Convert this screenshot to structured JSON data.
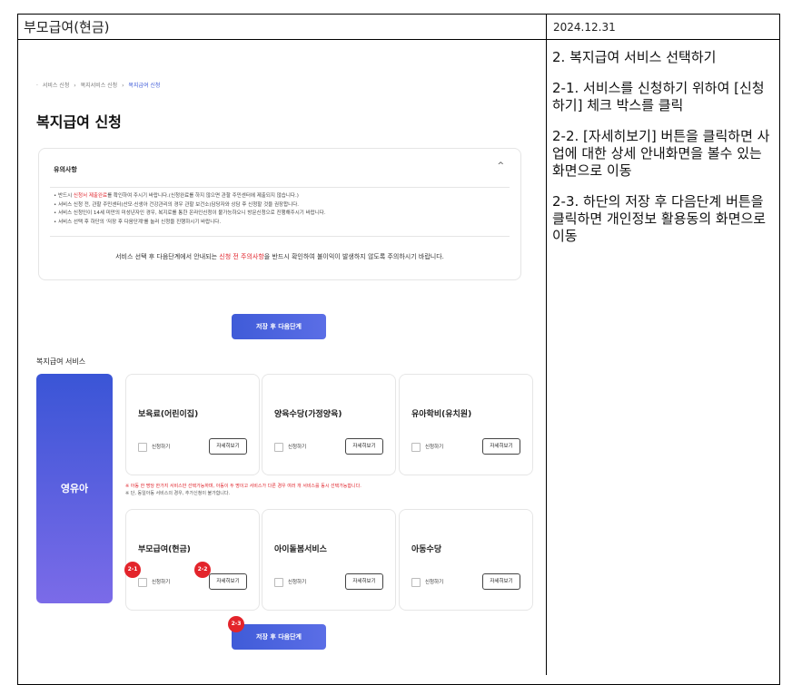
{
  "header": {
    "title": "부모급여(현금)",
    "date": "2024.12.31"
  },
  "side_notes": [
    "2. 복지급여 서비스 선택하기",
    "2-1. 서비스를 신청하기 위하여 [신청하기] 체크 박스를 클릭",
    "2-2. [자세히보기] 버튼을 클릭하면 사업에 대한 상세 안내화면을 볼수 있는 화면으로 이동",
    "2-3. 하단의 저장 후 다음단계 버튼을 클릭하면 개인정보 활용동의 화면으로 이동"
  ],
  "breadcrumb": [
    "서비스 신청",
    "복지서비스 신청",
    "복지급여 신청"
  ],
  "page_title": "복지급여 신청",
  "notice": {
    "title": "유의사항",
    "chevron": "^",
    "items": [
      {
        "pre": "• 반드시 ",
        "red": "신청서 제출완료",
        "post": "를 확인하여 주시기 바랍니다.(신청완료를 하지 않으면 관할 주민센터에 제출되지 않습니다.)"
      },
      {
        "pre": "• 서비스 신청 전, 관할 주민센터(산모·신생아 건강관리의 경우 관할 보건소)담당자와 상담 후 신청할 것을 권장합니다.",
        "red": "",
        "post": ""
      },
      {
        "pre": "• 서비스 신청인이 14세 미만의 미성년자인 경우, 복지로를 통한 온라인신청이 불가능하오니 방문신청으로 진행해주시기 바랍니다.",
        "red": "",
        "post": ""
      },
      {
        "pre": "• 서비스 선택 후 하단의 '저장 후 다음단계'를 눌러 신청을 진행하시기 바랍니다.",
        "red": "",
        "post": ""
      }
    ],
    "footer_pre": "서비스 선택 후 다음단계에서 안내되는 ",
    "footer_red": "신청 전 주의사항",
    "footer_post": "을 반드시 확인하여 불이익이 발생하지 않도록 주의하시기 바랍니다."
  },
  "save_next_label": "저장 후 다음단계",
  "section_label": "복지급여 서비스",
  "category": "영유아",
  "check_label": "신청하기",
  "detail_label": "자세히보기",
  "services_row1": [
    "보육료(어린이집)",
    "양육수당(가정양육)",
    "유아학비(유치원)"
  ],
  "services_row2": [
    "부모급여(현금)",
    "아이돌봄서비스",
    "아동수당"
  ],
  "warning": {
    "line1": "※ 아동 한 명당 한가지 서비스만 선택가능하며, 아동이 두 명이고 서비스가 다른 경우 여러 개 서비스를 동시 선택가능합니다.",
    "line2": "※ 단, 동일아동 서비스의 경우, 추가신청이 불가합니다."
  },
  "badges": [
    "2-1",
    "2-2",
    "2-3"
  ],
  "colors": {
    "accent": "#3f5bd8",
    "badge": "#e3242b",
    "warn": "#e0242c"
  }
}
